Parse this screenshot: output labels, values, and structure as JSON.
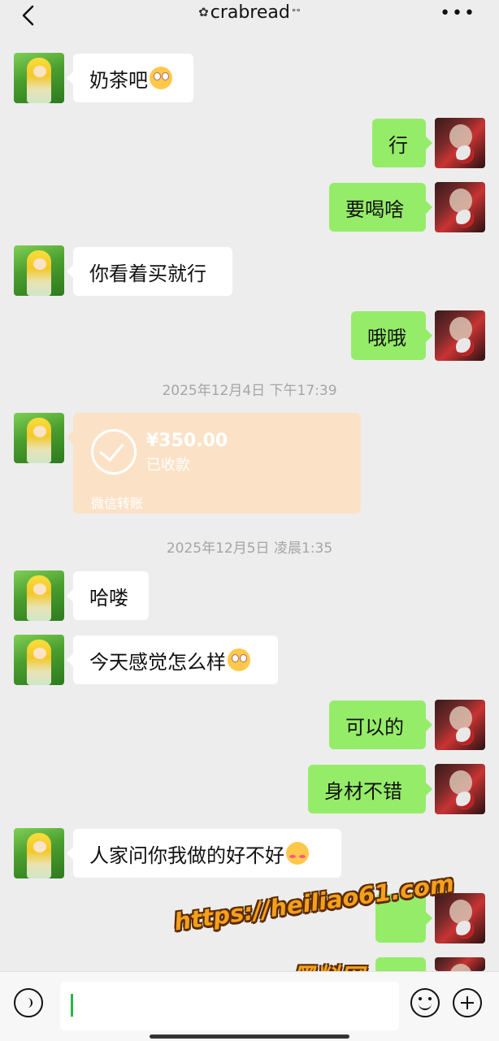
{
  "header": {
    "title": "crabread",
    "back_icon": "chevron-left-icon",
    "more_icon": "ellipsis-icon"
  },
  "messages": [
    {
      "side": "in",
      "text": "奶茶吧",
      "emoji": "eye-roll-emoji"
    },
    {
      "side": "out",
      "text": "行"
    },
    {
      "side": "out",
      "text": "要喝啥"
    },
    {
      "side": "in",
      "text": "你看着买就行"
    },
    {
      "side": "out",
      "text": "哦哦"
    },
    {
      "side": "in",
      "text": "哈喽"
    },
    {
      "side": "in",
      "text": "今天感觉怎么样",
      "emoji": "eye-roll-emoji"
    },
    {
      "side": "out",
      "text": "可以的"
    },
    {
      "side": "out",
      "text": "身材不错"
    },
    {
      "side": "in",
      "text": "人家问你我做的好不好",
      "emoji": "shy-emoji"
    },
    {
      "side": "out",
      "text": ""
    },
    {
      "side": "out",
      "text": ""
    }
  ],
  "timestamps": [
    "2025年12月4日 下午17:39",
    "2025年12月5日 凌晨1:35"
  ],
  "transfer": {
    "amount": "¥350.00",
    "status": "已收款",
    "label": "微信转账",
    "color": "#fbe2c7"
  },
  "watermark": {
    "url": "https://heiliao61.com",
    "name": "黑料网"
  },
  "input_bar": {
    "voice_icon": "voice-icon",
    "emoji_icon": "emoji-icon",
    "plus_icon": "plus-icon"
  },
  "colors": {
    "background": "#ededed",
    "outgoing_bubble": "#95ec69",
    "incoming_bubble": "#ffffff",
    "timestamp_text": "#a5a5a5"
  }
}
